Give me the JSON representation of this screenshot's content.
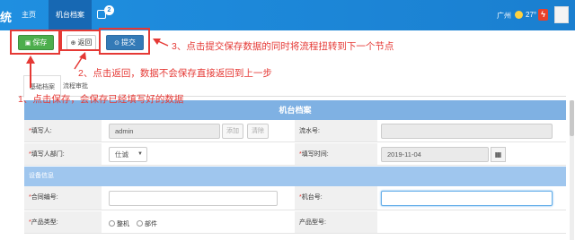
{
  "nav": {
    "brand": "统",
    "home": "主页",
    "machine_files": "机台档案",
    "apps_badge": "2",
    "city": "广州",
    "temperature": "27°",
    "alert": "ϟ"
  },
  "toolbar": {
    "save_label": "保存",
    "return_label": "返回",
    "submit_label": "提交"
  },
  "annotations": {
    "note_1": "1、点击保存，会保存已经填写好的数据",
    "note_2": "2、点击返回，数据不会保存直接返回到上一步",
    "note_3": "3、点击提交保存数据的同时将流程扭转到下一个节点"
  },
  "tabs": {
    "basic": "基础档案",
    "flow": "流程审批"
  },
  "form": {
    "title": "机台档案",
    "section_equipment": "设备信息",
    "filler_label": "填写人:",
    "filler_value": "admin",
    "add_button": "添加",
    "clear_button": "清除",
    "serial_label": "流水号:",
    "serial_value": "",
    "dept_label": "填写人部门:",
    "dept_value": "仕诚",
    "dept_arrow": "▼",
    "date_label": "填写时间:",
    "date_value": "2019-11-04",
    "calendar_icon": "▦",
    "contract_label": "合同编号:",
    "contract_value": "",
    "machine_no_label": "机台号:",
    "machine_no_value": "",
    "product_type_label": "产品类型:",
    "product_type_opt1": "整机",
    "product_type_opt2": "部件",
    "model_label": "产品型号:"
  }
}
